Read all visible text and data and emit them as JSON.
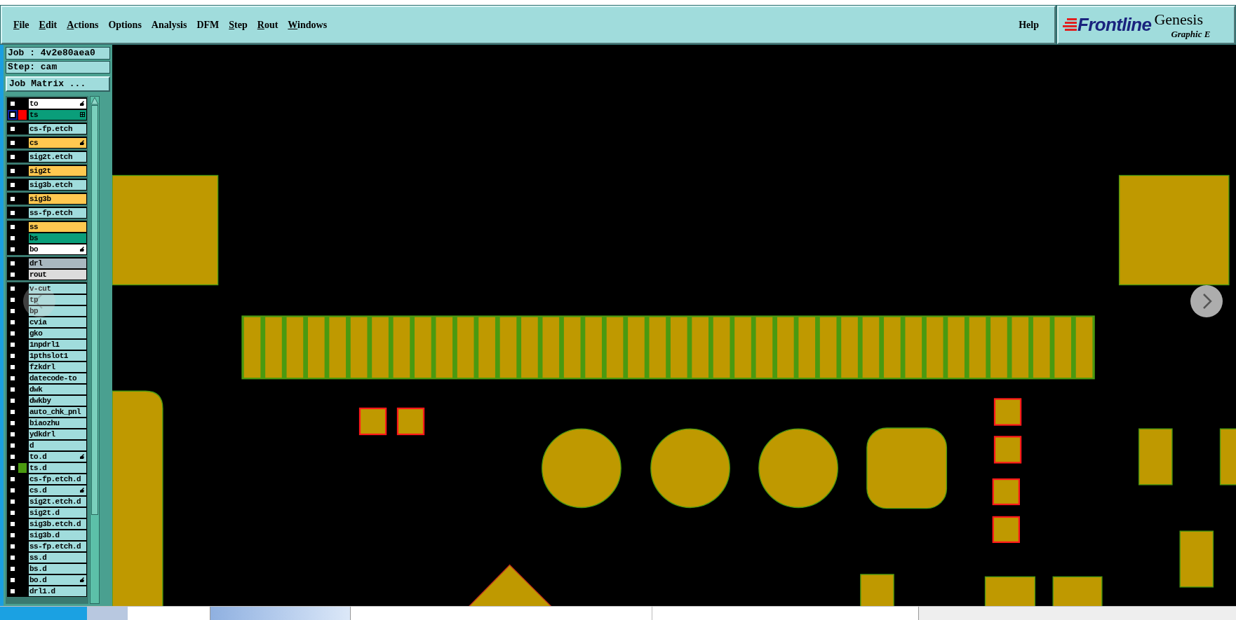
{
  "menu": [
    {
      "label": "File",
      "underlined": true
    },
    {
      "label": "Edit",
      "underlined": true
    },
    {
      "label": "Actions",
      "underlined": true
    },
    {
      "label": "Options",
      "underlined": false
    },
    {
      "label": "Analysis",
      "underlined": false
    },
    {
      "label": "DFM",
      "underlined": false
    },
    {
      "label": "Step",
      "underlined": true
    },
    {
      "label": "Rout",
      "underlined": true
    },
    {
      "label": "Windows",
      "underlined": true
    }
  ],
  "help": "Help",
  "logo": {
    "brand": "Frontline",
    "product": "Genesis",
    "subtitle": "Graphic E"
  },
  "job": "Job : 4v2e80aea0",
  "step": "Step: cam",
  "job_matrix_button": "Job Matrix ...",
  "layer_groups": [
    [
      {
        "name": "to",
        "color": "#ffffff",
        "kind": "pointer",
        "selected": false
      },
      {
        "name": "ts",
        "color": "#0a9e7a",
        "kind": "grid",
        "selected": true,
        "swatch": {
          "color": "#ff0000"
        }
      }
    ],
    [
      {
        "name": "cs-fp.etch",
        "color": "#a0dcdc",
        "kind": "plain",
        "selected": false
      }
    ],
    [
      {
        "name": "cs",
        "color": "#ffc850",
        "kind": "pointer",
        "selected": false
      }
    ],
    [
      {
        "name": "sig2t.etch",
        "color": "#a0dcdc",
        "kind": "plain",
        "selected": false
      }
    ],
    [
      {
        "name": "sig2t",
        "color": "#ffc850",
        "kind": "plain",
        "selected": false
      }
    ],
    [
      {
        "name": "sig3b.etch",
        "color": "#a0dcdc",
        "kind": "plain",
        "selected": false
      }
    ],
    [
      {
        "name": "sig3b",
        "color": "#ffc850",
        "kind": "plain",
        "selected": false
      }
    ],
    [
      {
        "name": "ss-fp.etch",
        "color": "#a0dcdc",
        "kind": "plain",
        "selected": false
      }
    ],
    [
      {
        "name": "ss",
        "color": "#ffc850",
        "kind": "plain",
        "selected": false
      },
      {
        "name": "bs",
        "color": "#0a9e7a",
        "kind": "plain",
        "selected": false
      },
      {
        "name": "bo",
        "color": "#ffffff",
        "kind": "pointer",
        "selected": false
      }
    ],
    [
      {
        "name": "drl",
        "color": "#a8b8c0",
        "kind": "plain",
        "selected": false
      },
      {
        "name": "rout",
        "color": "#dcdcdc",
        "kind": "plain",
        "selected": false
      }
    ],
    [
      {
        "name": "v-cut",
        "color": "#a0dcdc",
        "kind": "plain",
        "selected": false
      },
      {
        "name": "tp",
        "color": "#a0dcdc",
        "kind": "plain",
        "selected": false
      },
      {
        "name": "bp",
        "color": "#a0dcdc",
        "kind": "plain",
        "selected": false
      },
      {
        "name": "cvia",
        "color": "#a0dcdc",
        "kind": "plain",
        "selected": false
      },
      {
        "name": "gko",
        "color": "#a0dcdc",
        "kind": "plain",
        "selected": false
      },
      {
        "name": "1npdrl1",
        "color": "#a0dcdc",
        "kind": "plain",
        "selected": false
      },
      {
        "name": "1pthslot1",
        "color": "#a0dcdc",
        "kind": "plain",
        "selected": false
      },
      {
        "name": "fzkdrl",
        "color": "#a0dcdc",
        "kind": "plain",
        "selected": false
      },
      {
        "name": "datecode-to",
        "color": "#a0dcdc",
        "kind": "plain",
        "selected": false
      },
      {
        "name": "dwk",
        "color": "#a0dcdc",
        "kind": "plain",
        "selected": false
      },
      {
        "name": "dwkby",
        "color": "#a0dcdc",
        "kind": "plain",
        "selected": false
      },
      {
        "name": "auto_chk_pnl",
        "color": "#a0dcdc",
        "kind": "plain",
        "selected": false
      },
      {
        "name": "biaozhu",
        "color": "#a0dcdc",
        "kind": "plain",
        "selected": false
      },
      {
        "name": "ydkdrl",
        "color": "#a0dcdc",
        "kind": "plain",
        "selected": false
      },
      {
        "name": "d",
        "color": "#a0dcdc",
        "kind": "plain",
        "selected": false
      },
      {
        "name": "to.d",
        "color": "#a0dcdc",
        "kind": "pointer",
        "selected": false
      },
      {
        "name": "ts.d",
        "color": "#a0dcdc",
        "kind": "plain",
        "selected": false,
        "swatch": {
          "color": "#4a9a10"
        }
      },
      {
        "name": "cs-fp.etch.d",
        "color": "#a0dcdc",
        "kind": "plain",
        "selected": false
      },
      {
        "name": "cs.d",
        "color": "#a0dcdc",
        "kind": "pointer",
        "selected": false
      },
      {
        "name": "sig2t.etch.d",
        "color": "#a0dcdc",
        "kind": "plain",
        "selected": false
      },
      {
        "name": "sig2t.d",
        "color": "#a0dcdc",
        "kind": "plain",
        "selected": false
      },
      {
        "name": "sig3b.etch.d",
        "color": "#a0dcdc",
        "kind": "plain",
        "selected": false
      },
      {
        "name": "sig3b.d",
        "color": "#a0dcdc",
        "kind": "plain",
        "selected": false
      },
      {
        "name": "ss-fp.etch.d",
        "color": "#a0dcdc",
        "kind": "plain",
        "selected": false
      },
      {
        "name": "ss.d",
        "color": "#a0dcdc",
        "kind": "plain",
        "selected": false
      },
      {
        "name": "bs.d",
        "color": "#a0dcdc",
        "kind": "plain",
        "selected": false
      },
      {
        "name": "bo.d",
        "color": "#a0dcdc",
        "kind": "pointer",
        "selected": false
      },
      {
        "name": "drl1.d",
        "color": "#a0dcdc",
        "kind": "plain",
        "selected": false
      }
    ]
  ]
}
